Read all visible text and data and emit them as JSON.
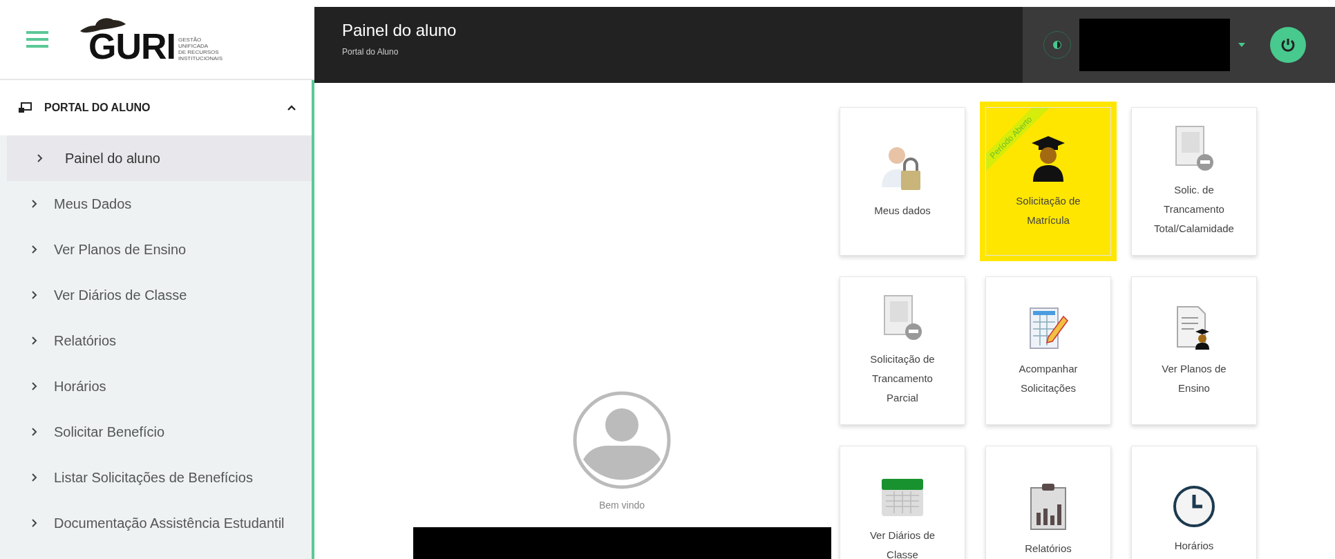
{
  "logo": {
    "wordmark": "GURI",
    "tagline": [
      "GESTÃO",
      "UNIFICADA",
      "DE RECURSOS",
      "INSTITUCIONAIS"
    ]
  },
  "header": {
    "title": "Painel do aluno",
    "subtitle": "Portal do Aluno"
  },
  "sidebar": {
    "section": {
      "label": "PORTAL DO ALUNO",
      "expanded": true
    },
    "items": [
      {
        "label": "Painel do aluno",
        "selected": true
      },
      {
        "label": "Meus Dados",
        "selected": false
      },
      {
        "label": "Ver Planos de Ensino",
        "selected": false
      },
      {
        "label": "Ver Diários de Classe",
        "selected": false
      },
      {
        "label": "Relatórios",
        "selected": false
      },
      {
        "label": "Horários",
        "selected": false
      },
      {
        "label": "Solicitar Benefício",
        "selected": false
      },
      {
        "label": "Listar Solicitações de Benefícios",
        "selected": false
      },
      {
        "label": "Documentação Assistência Estudantil",
        "selected": false
      }
    ]
  },
  "profile": {
    "greeting": "Bem vindo"
  },
  "cards": [
    {
      "label": "Meus dados",
      "kind": "user-lock",
      "highlighted": false
    },
    {
      "label": "Solicitação de Matrícula",
      "kind": "graduate",
      "highlighted": true,
      "ribbon": "Período Aberto"
    },
    {
      "label": "Solic. de Trancamento Total/Calamidade",
      "kind": "document-minus",
      "highlighted": false
    },
    {
      "label": "Solicitação de Trancamento Parcial",
      "kind": "document-minus",
      "highlighted": false
    },
    {
      "label": "Acompanhar Solicitações",
      "kind": "spreadsheet",
      "highlighted": false
    },
    {
      "label": "Ver Planos de Ensino",
      "kind": "document-graduate",
      "highlighted": false
    },
    {
      "label": "Ver Diários de Classe",
      "kind": "calendar",
      "highlighted": false
    },
    {
      "label": "Relatórios",
      "kind": "clipboard-chart",
      "highlighted": false
    },
    {
      "label": "Horários",
      "kind": "clock",
      "highlighted": false
    }
  ]
}
